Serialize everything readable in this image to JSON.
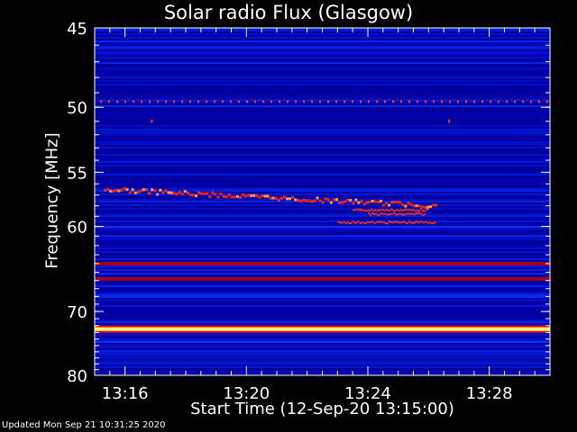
{
  "chart_data": {
    "type": "heatmap",
    "title": "Solar radio Flux (Glasgow)",
    "xlabel": "Start Time (12-Sep-20 13:15:00)",
    "ylabel": "Frequency [MHz]",
    "x_ticks": [
      "13:16",
      "13:20",
      "13:24",
      "13:28"
    ],
    "x_tick_minutes": [
      1,
      5,
      9,
      13
    ],
    "x_range_minutes": [
      0,
      15
    ],
    "y_ticks": [
      45,
      50,
      55,
      60,
      70,
      80
    ],
    "y_range": [
      45,
      80
    ],
    "y_scale": "reciprocal",
    "colormap": [
      "#0000a0",
      "#1030ff",
      "#ff0000",
      "#ffff80"
    ],
    "bright_bands_mhz": [
      {
        "freq": 64.0,
        "level": "red"
      },
      {
        "freq": 65.8,
        "level": "red"
      },
      {
        "freq": 72.5,
        "level": "white"
      }
    ],
    "burst": {
      "start_minute": 0.3,
      "end_minute": 11.2,
      "freq_start": 56.5,
      "freq_end": 58.0
    }
  },
  "footer": "Updated Mon Sep 21 10:31:25 2020",
  "colors": {
    "background": "#000000",
    "axis": "#ffffff"
  }
}
